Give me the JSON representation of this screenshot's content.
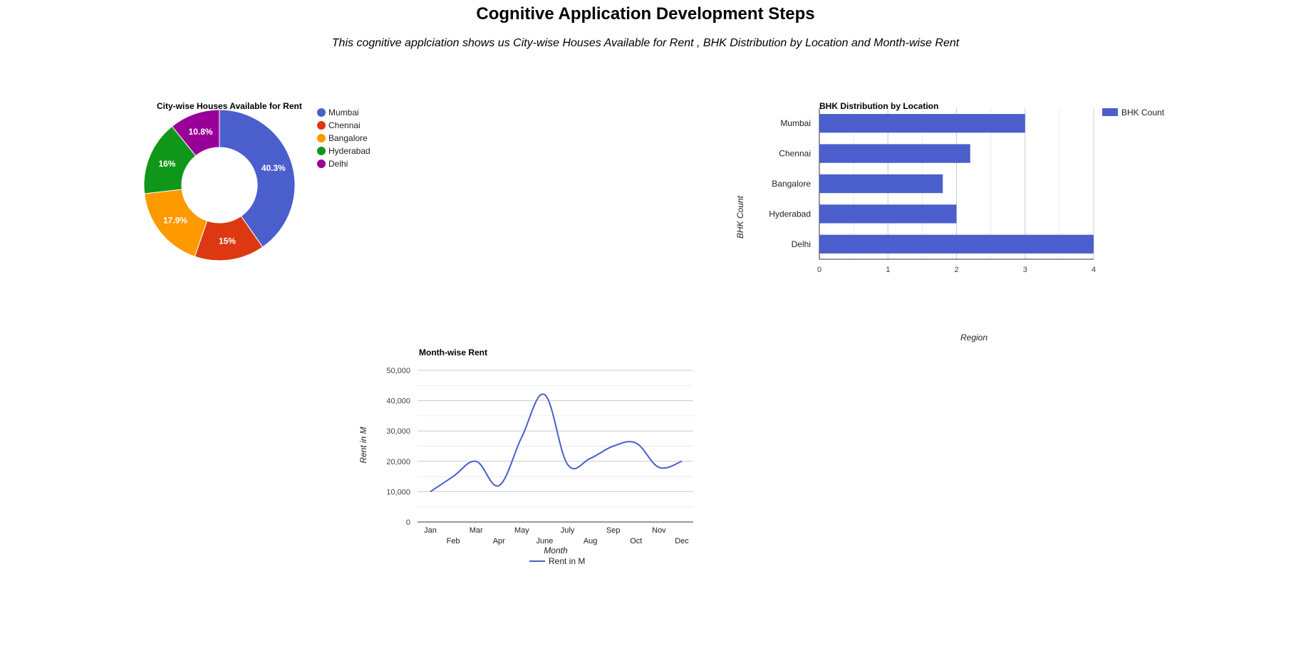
{
  "page": {
    "title": "Cognitive Application Development Steps",
    "subtitle": "This cognitive applciation shows us City-wise Houses Available for Rent , BHK Distribution by Location and Month-wise Rent"
  },
  "colors": {
    "blue": "#4a5fcc",
    "red": "#dc3912",
    "orange": "#ff9900",
    "green": "#109618",
    "purple": "#990099",
    "grid": "#e3e3e3",
    "axis": "#333333"
  },
  "chart_data": [
    {
      "type": "pie",
      "donut": true,
      "title": "City-wise Houses Available for Rent",
      "legend_position": "right",
      "slices": [
        {
          "label": "Mumbai",
          "value": 40.3,
          "percent_label": "40.3%",
          "color": "#4a5fcc"
        },
        {
          "label": "Chennai",
          "value": 15,
          "percent_label": "15%",
          "color": "#dc3912"
        },
        {
          "label": "Bangalore",
          "value": 17.9,
          "percent_label": "17.9%",
          "color": "#ff9900"
        },
        {
          "label": "Hyderabad",
          "value": 16,
          "percent_label": "16%",
          "color": "#109618"
        },
        {
          "label": "Delhi",
          "value": 10.8,
          "percent_label": "10.8%",
          "color": "#990099"
        }
      ]
    },
    {
      "type": "bar",
      "orientation": "horizontal",
      "title": "BHK Distribution by Location",
      "categories": [
        "Mumbai",
        "Chennai",
        "Bangalore",
        "Hyderabad",
        "Delhi"
      ],
      "series": [
        {
          "name": "BHK Count",
          "values": [
            3,
            2.2,
            1.8,
            2,
            4
          ],
          "color": "#4a5fcc"
        }
      ],
      "xlabel": "Region",
      "ylabel": "BHK Count",
      "xlim": [
        0,
        4
      ],
      "xticks": [
        "0",
        "1",
        "2",
        "3",
        "4"
      ],
      "grid": true,
      "legend_position": "top-right"
    },
    {
      "type": "line",
      "title": "Month-wise Rent",
      "categories": [
        "Jan",
        "Feb",
        "Mar",
        "Apr",
        "May",
        "June",
        "July",
        "Aug",
        "Sep",
        "Oct",
        "Nov",
        "Dec"
      ],
      "series": [
        {
          "name": "Rent in M",
          "values": [
            10000,
            15000,
            20000,
            12000,
            28000,
            42000,
            19000,
            21000,
            25000,
            26000,
            18000,
            20000
          ],
          "color": "#4a5fcc"
        }
      ],
      "xlabel": "Month",
      "ylabel": "Rent in M",
      "ylim": [
        0,
        50000
      ],
      "yticks": [
        "0",
        "10,000",
        "20,000",
        "30,000",
        "40,000",
        "50,000"
      ],
      "grid": true,
      "smooth": true,
      "legend_position": "bottom"
    }
  ]
}
